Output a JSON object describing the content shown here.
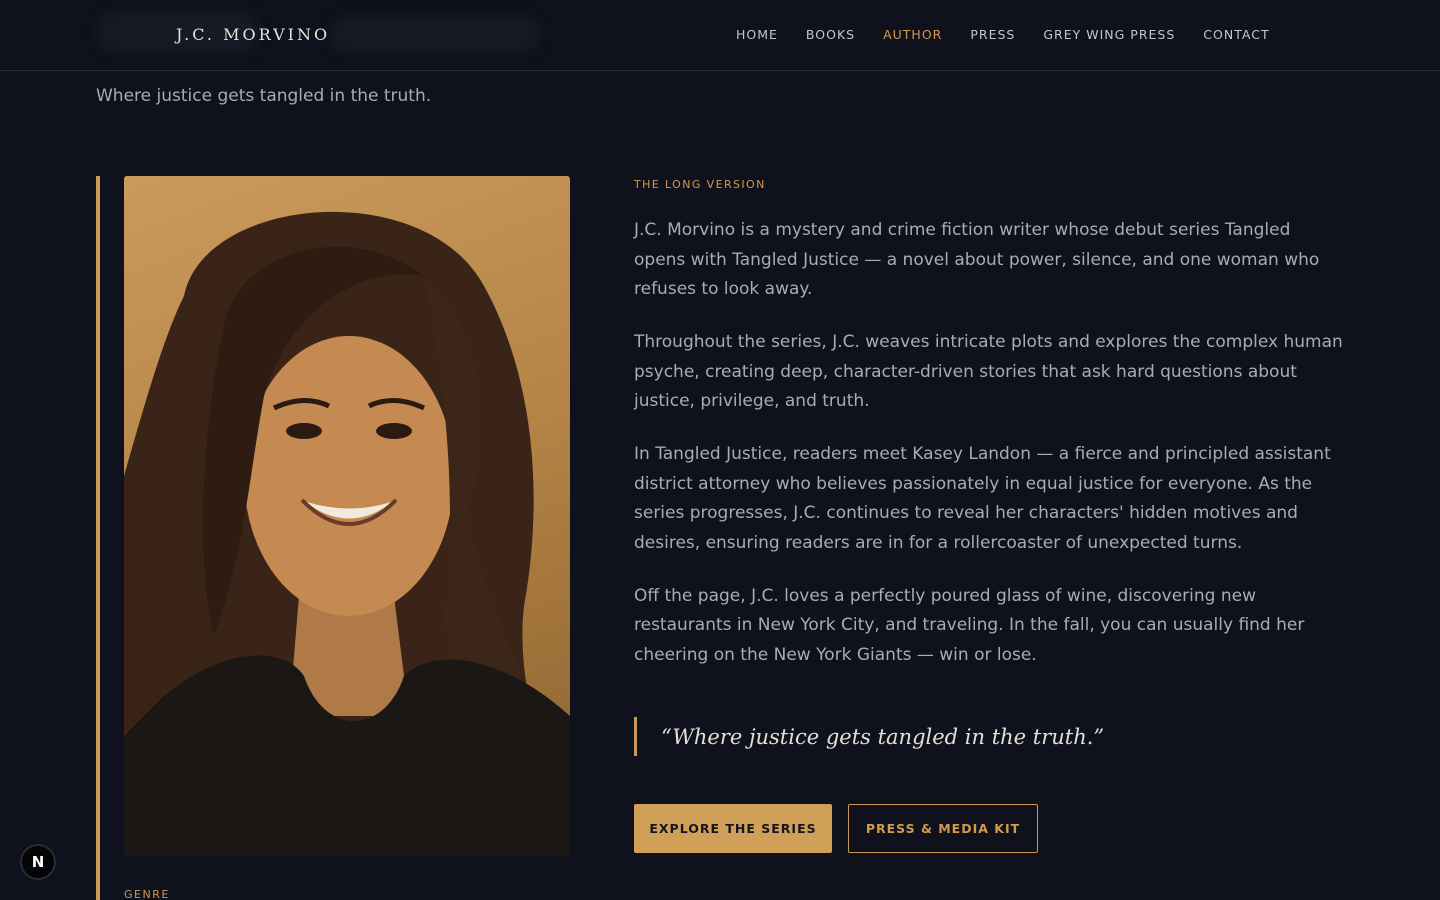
{
  "header": {
    "logo": "J.C. MORVINO",
    "nav": [
      {
        "label": "HOME",
        "active": false
      },
      {
        "label": "BOOKS",
        "active": false
      },
      {
        "label": "AUTHOR",
        "active": true
      },
      {
        "label": "PRESS",
        "active": false
      },
      {
        "label": "GREY WING PRESS",
        "active": false
      },
      {
        "label": "CONTACT",
        "active": false
      }
    ]
  },
  "tagline": "Where justice gets tangled in the truth.",
  "photo": {
    "alt": "Portrait of J.C. Morvino"
  },
  "genre_label": "GENRE",
  "bio": {
    "eyebrow": "THE LONG VERSION",
    "paragraphs": [
      "J.C. Morvino is a mystery and crime fiction writer whose debut series Tangled opens with Tangled Justice — a novel about power, silence, and one woman who refuses to look away.",
      "Throughout the series, J.C. weaves intricate plots and explores the complex human psyche, creating deep, character-driven stories that ask hard questions about justice, privilege, and truth.",
      "In Tangled Justice, readers meet Kasey Landon — a fierce and principled assistant district attorney who believes passionately in equal justice for everyone. As the series progresses, J.C. continues to reveal her characters' hidden motives and desires, ensuring readers are in for a rollercoaster of unexpected turns.",
      "Off the page, J.C. loves a perfectly poured glass of wine, discovering new restaurants in New York City, and traveling. In the fall, you can usually find her cheering on the New York Giants — win or lose."
    ],
    "quote": "“Where justice gets tangled in the truth.”"
  },
  "buttons": {
    "primary": "EXPLORE THE SERIES",
    "secondary": "PRESS & MEDIA KIT"
  },
  "badge": "N",
  "colors": {
    "background": "#0f111c",
    "accent": "#d49a4c",
    "text": "#a8acb9"
  }
}
